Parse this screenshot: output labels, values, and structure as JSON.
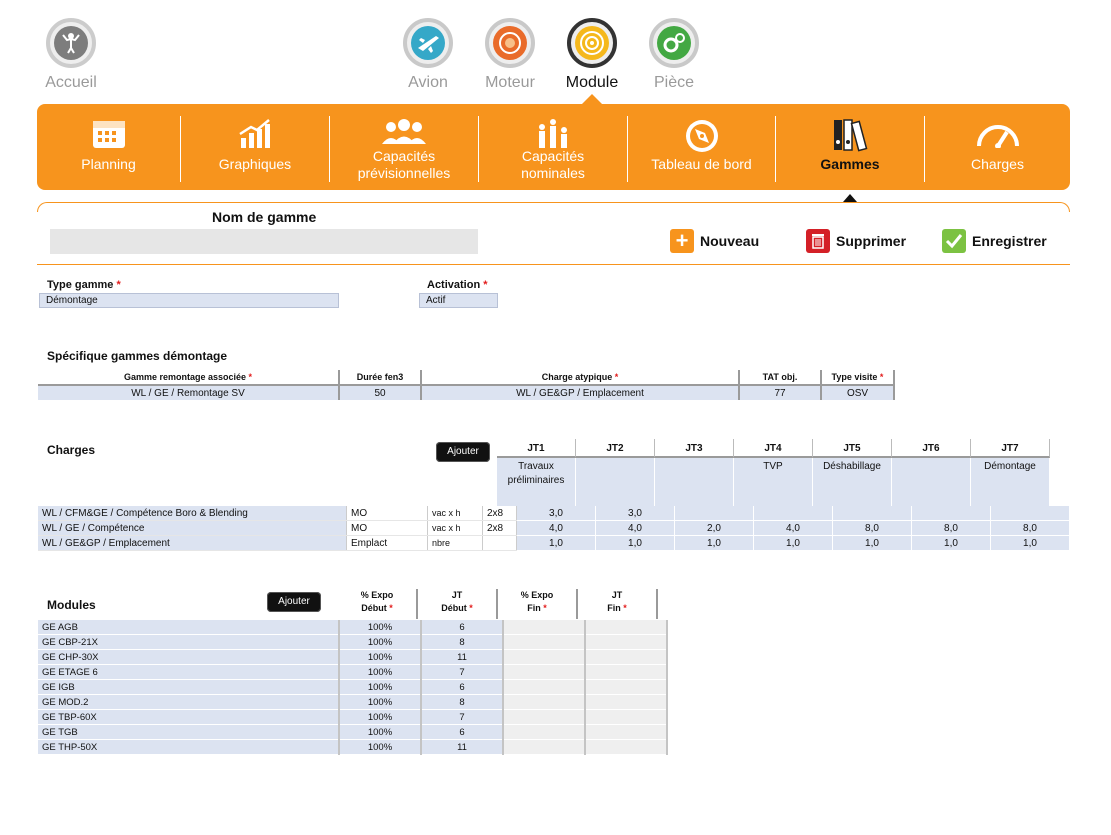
{
  "topnav": {
    "home": "Accueil",
    "items": [
      "Avion",
      "Moteur",
      "Module",
      "Pièce"
    ],
    "active": "Module"
  },
  "tabs": [
    {
      "label": "Planning",
      "icon": "calendar-icon"
    },
    {
      "label": "Graphiques",
      "icon": "bar-chart-icon"
    },
    {
      "label1": "Capacités",
      "label2": "prévisionnelles",
      "icon": "people-icon"
    },
    {
      "label1": "Capacités",
      "label2": "nominales",
      "icon": "people-bars-icon"
    },
    {
      "label": "Tableau de bord",
      "icon": "compass-icon"
    },
    {
      "label": "Gammes",
      "icon": "binders-icon"
    },
    {
      "label": "Charges",
      "icon": "gauge-icon"
    }
  ],
  "form": {
    "nom_label": "Nom de gamme",
    "nom_value": "",
    "actions": {
      "new": "Nouveau",
      "delete": "Supprimer",
      "save": "Enregistrer"
    },
    "type_label": "Type gamme",
    "type_value": "Démontage",
    "activation_label": "Activation",
    "activation_value": "Actif",
    "req": "*"
  },
  "specific": {
    "title": "Spécifique gammes démontage",
    "headers": [
      "Gamme remontage associée",
      "Durée fen3",
      "Charge atypique",
      "TAT obj.",
      "Type visite"
    ],
    "row": [
      "WL / GE / Remontage SV",
      "50",
      "WL / GE&GP / Emplacement",
      "77",
      "OSV"
    ]
  },
  "charges": {
    "title": "Charges",
    "add": "Ajouter",
    "jt": [
      "JT1",
      "JT2",
      "JT3",
      "JT4",
      "JT5",
      "JT6",
      "JT7"
    ],
    "descriptions": [
      "Travaux préliminaires",
      "",
      "",
      "TVP",
      "Déshabillage",
      "",
      "Démontage"
    ],
    "rows": [
      {
        "name": "WL / CFM&GE / Compétence Boro & Blending",
        "type": "MO",
        "unit": "vac x h",
        "factor": "2x8",
        "values": [
          "3,0",
          "3,0",
          "",
          "",
          "",
          "",
          ""
        ]
      },
      {
        "name": "WL / GE / Compétence",
        "type": "MO",
        "unit": "vac x h",
        "factor": "2x8",
        "values": [
          "4,0",
          "4,0",
          "2,0",
          "4,0",
          "8,0",
          "8,0",
          "8,0"
        ]
      },
      {
        "name": "WL / GE&GP / Emplacement",
        "type": "Emplact",
        "unit": "nbre",
        "factor": "",
        "values": [
          "1,0",
          "1,0",
          "1,0",
          "1,0",
          "1,0",
          "1,0",
          "1,0"
        ]
      }
    ]
  },
  "modules": {
    "title": "Modules",
    "add": "Ajouter",
    "headers": [
      [
        "% Expo",
        "Début"
      ],
      [
        "JT",
        "Début"
      ],
      [
        "% Expo",
        "Fin"
      ],
      [
        "JT",
        "Fin"
      ]
    ],
    "rows": [
      {
        "name": "GE AGB",
        "expo": "100%",
        "jt": "6"
      },
      {
        "name": "GE CBP-21X",
        "expo": "100%",
        "jt": "8"
      },
      {
        "name": "GE CHP-30X",
        "expo": "100%",
        "jt": "11"
      },
      {
        "name": "GE ETAGE 6",
        "expo": "100%",
        "jt": "7"
      },
      {
        "name": "GE IGB",
        "expo": "100%",
        "jt": "6"
      },
      {
        "name": "GE MOD.2",
        "expo": "100%",
        "jt": "8"
      },
      {
        "name": "GE TBP-60X",
        "expo": "100%",
        "jt": "7"
      },
      {
        "name": "GE TGB",
        "expo": "100%",
        "jt": "6"
      },
      {
        "name": "GE THP-50X",
        "expo": "100%",
        "jt": "11"
      }
    ]
  },
  "colors": {
    "accent": "#f7941d",
    "field": "#dce3f1",
    "required": "#e21b1b"
  }
}
